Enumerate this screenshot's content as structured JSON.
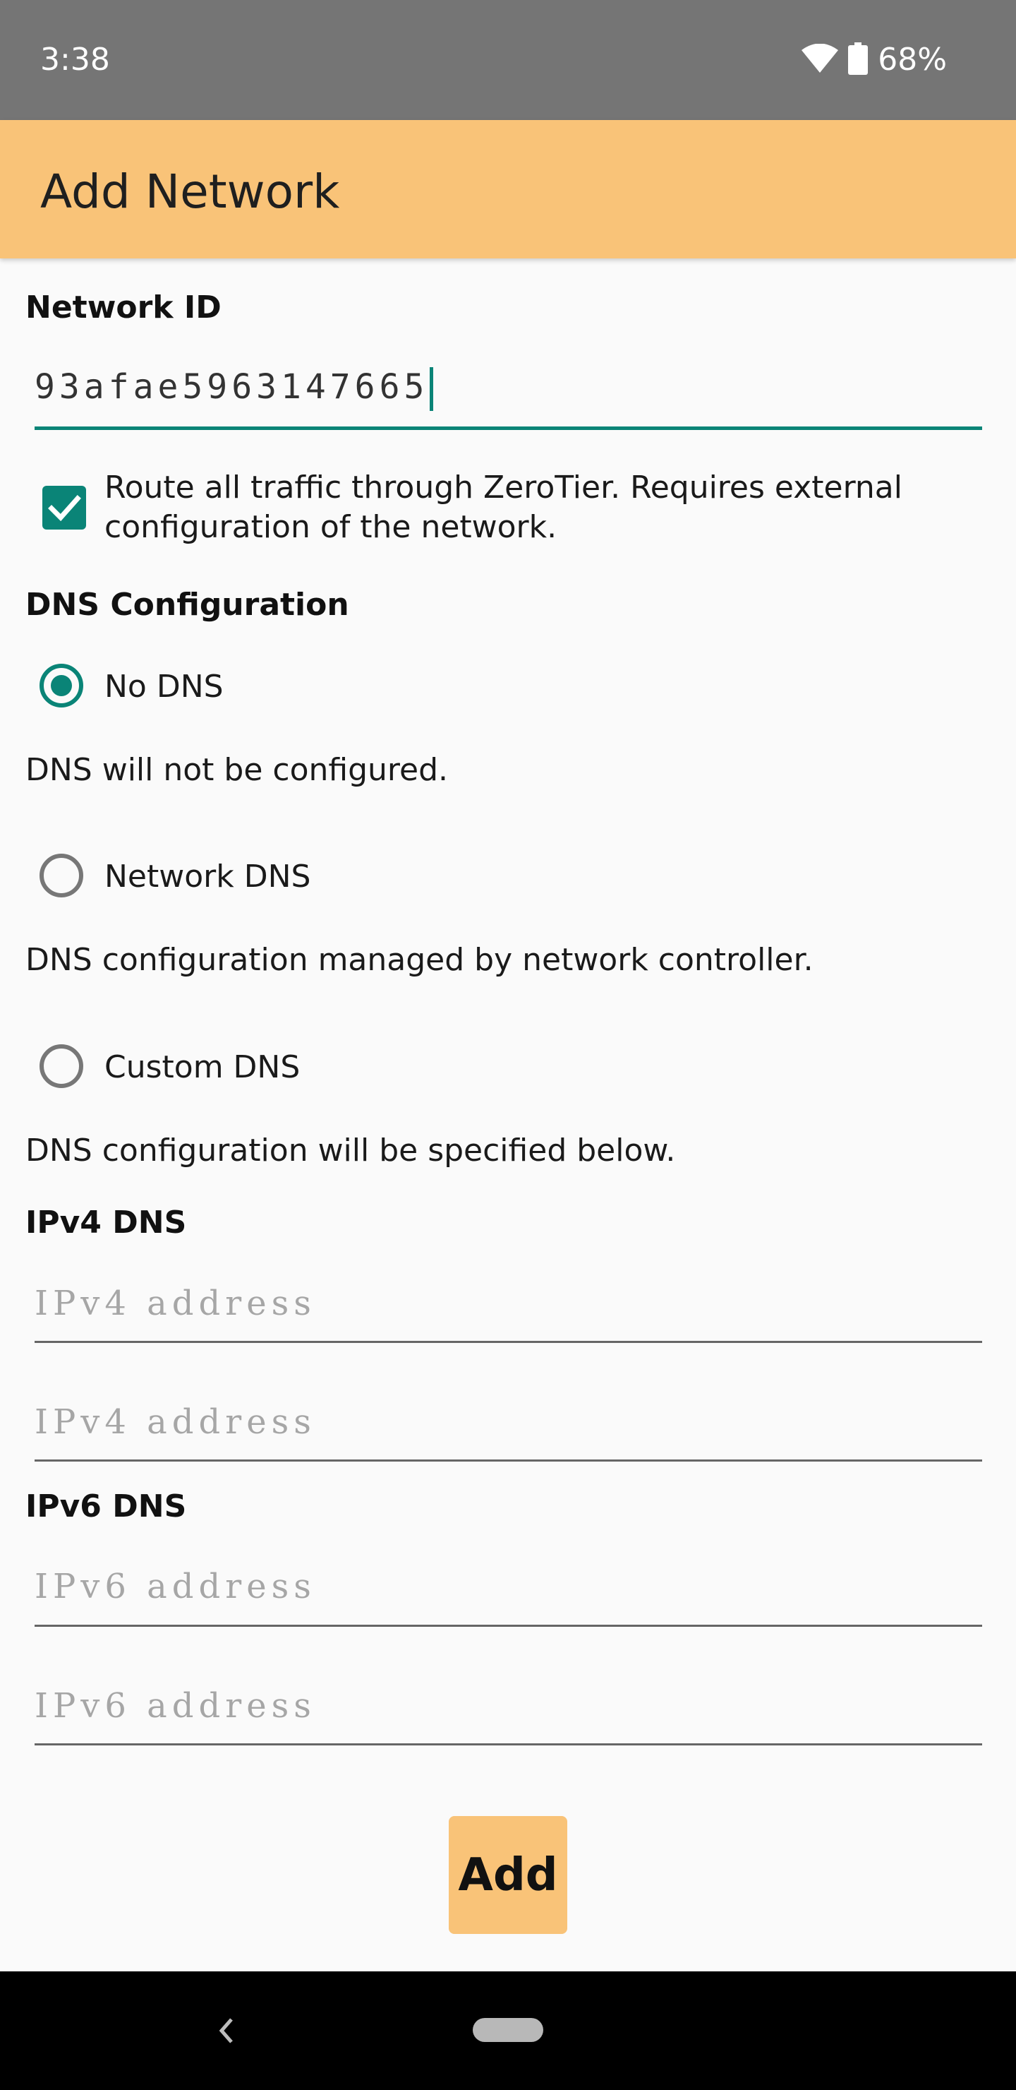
{
  "status_bar": {
    "time": "3:38",
    "battery_percent": "68%",
    "icons": [
      "wifi-icon",
      "battery-icon"
    ]
  },
  "app_bar": {
    "title": "Add Network",
    "color": "#f9c378"
  },
  "form": {
    "network_id_label": "Network ID",
    "network_id_value": "93afae5963147665",
    "route_all_checked": true,
    "route_all_label": "Route all traffic through ZeroTier. Requires external configuration of the network.",
    "dns_section_label": "DNS Configuration",
    "dns_options": [
      {
        "label": "No DNS",
        "description": "DNS will not be configured.",
        "selected": true
      },
      {
        "label": "Network DNS",
        "description": "DNS configuration managed by network controller.",
        "selected": false
      },
      {
        "label": "Custom DNS",
        "description": "DNS configuration will be specified below.",
        "selected": false
      }
    ],
    "ipv4_label": "IPv4 DNS",
    "ipv4_fields": [
      {
        "value": "",
        "placeholder": "IPv4 address"
      },
      {
        "value": "",
        "placeholder": "IPv4 address"
      }
    ],
    "ipv6_label": "IPv6 DNS",
    "ipv6_fields": [
      {
        "value": "",
        "placeholder": "IPv6 address"
      },
      {
        "value": "",
        "placeholder": "IPv6 address"
      }
    ],
    "add_button_label": "Add"
  },
  "colors": {
    "accent": "#0a8477",
    "app_bar": "#f9c378",
    "status_bar": "#757575"
  },
  "nav_bar": {
    "icons": [
      "back-icon",
      "home-pill-icon"
    ]
  }
}
